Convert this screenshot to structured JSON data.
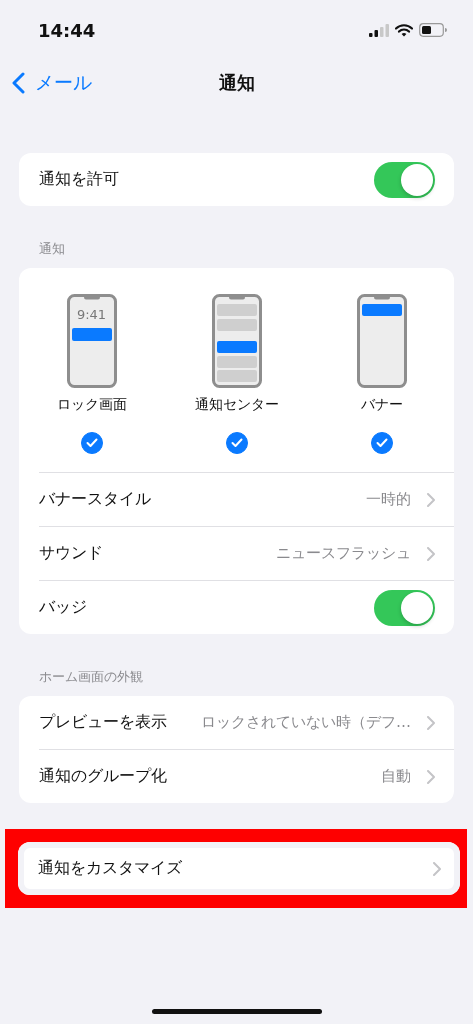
{
  "status_bar": {
    "time": "14:44"
  },
  "nav": {
    "back": "メール",
    "title": "通知"
  },
  "allow": {
    "label": "通知を許可",
    "on": true
  },
  "alerts_section": {
    "header": "通知",
    "styles": [
      {
        "kind": "lock",
        "clock": "9:41",
        "label": "ロック画面",
        "selected": true
      },
      {
        "kind": "center",
        "label": "通知センター",
        "selected": true
      },
      {
        "kind": "banner",
        "label": "バナー",
        "selected": true
      }
    ],
    "rows": [
      {
        "kind": "link",
        "label": "バナースタイル",
        "value": "一時的"
      },
      {
        "kind": "link",
        "label": "サウンド",
        "value": "ニュースフラッシュ"
      },
      {
        "kind": "toggle",
        "label": "バッジ",
        "on": true
      }
    ]
  },
  "appearance_section": {
    "header": "ホーム画面の外観",
    "rows": [
      {
        "kind": "link",
        "label": "プレビューを表示",
        "value": "ロックされていない時（デフ…"
      },
      {
        "kind": "link",
        "label": "通知のグループ化",
        "value": "自動"
      }
    ]
  },
  "customize": {
    "label": "通知をカスタマイズ",
    "highlighted": true
  }
}
